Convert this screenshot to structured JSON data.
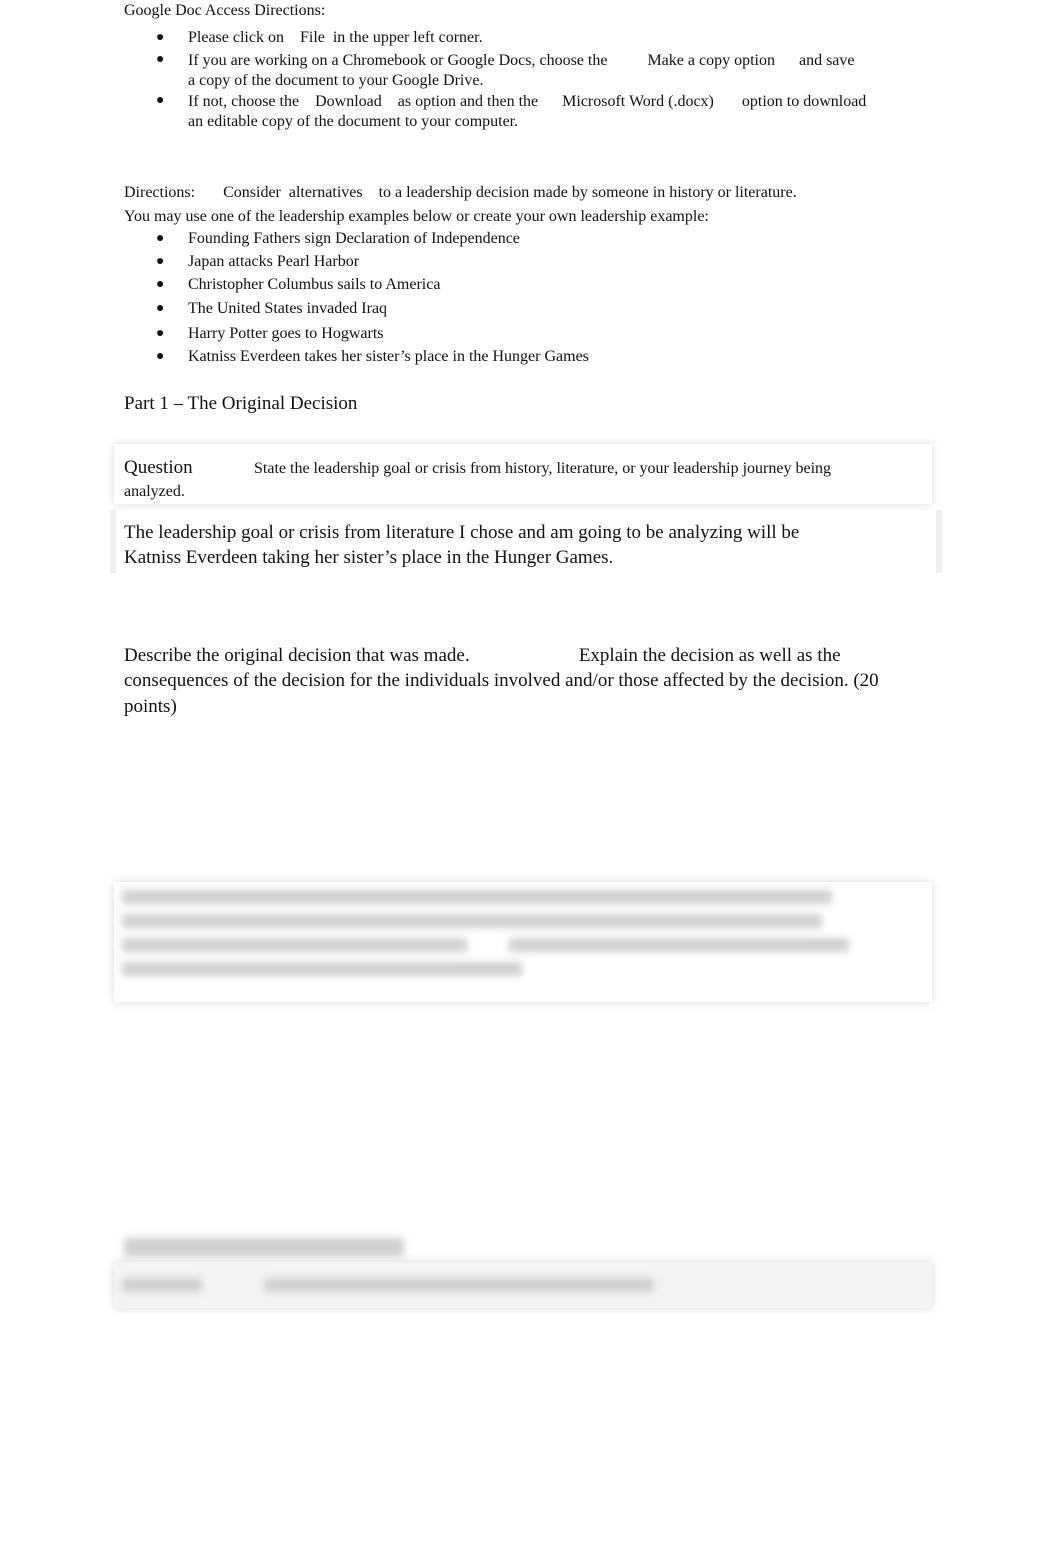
{
  "access": {
    "title": "Google Doc Access Directions:",
    "items": [
      [
        "Please click on    File  in the upper left corner."
      ],
      [
        "If you are working on a Chromebook or Google Docs, choose the          Make a copy option      and save",
        "a copy of the document to your Google Drive."
      ],
      [
        "If not, choose the    Download    as option and then the      Microsoft Word (.docx)       option to download",
        "an editable copy of the document to your computer."
      ]
    ]
  },
  "directions": {
    "line1": "Directions:       Consider  alternatives    to a leadership decision made by someone in history or literature.",
    "line2": "You may use one of the leadership examples below or create your own leadership example:",
    "examples": [
      "Founding Fathers sign Declaration of Independence",
      "Japan attacks Pearl Harbor",
      "Christopher Columbus sails to America",
      "The United States invaded Iraq",
      "Harry Potter goes to Hogwarts",
      "Katniss Everdeen takes her sister’s place in the Hunger Games"
    ]
  },
  "part1": {
    "heading": "Part 1 – The Original Decision",
    "question_label": "Question",
    "question_text": "State the leadership goal or crisis from history, literature, or your leadership journey being",
    "question_text2": "analyzed.",
    "answer1": "The leadership goal or crisis from literature I chose and am going to be analyzing will be",
    "answer2": "Katniss Everdeen taking her sister’s place in the Hunger Games.",
    "describe1": "Describe the original decision that was made.                       Explain the decision as well as the",
    "describe2": "consequences of the decision for the individuals involved and/or those affected by the decision. (20",
    "describe3": "points)"
  },
  "bullet": "●"
}
